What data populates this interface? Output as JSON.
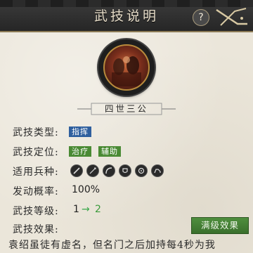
{
  "header": {
    "title": "武技说明",
    "help_label": "?"
  },
  "skill": {
    "name": "四世三公",
    "type_label": "武技类型:",
    "type_tag": "指挥",
    "position_label": "武技定位:",
    "position_tags": [
      "治疗",
      "辅助"
    ],
    "units_label": "适用兵种:",
    "unit_icons": [
      "sword-icon",
      "spear-icon",
      "bow-icon",
      "shield-icon",
      "wheel-icon",
      "cavalry-icon"
    ],
    "chance_label": "发动概率:",
    "chance_value": "100%",
    "level_label": "武技等级:",
    "level_from": "1",
    "level_arrow": "→",
    "level_to": "2",
    "effect_label": "武技效果:",
    "max_button": "满级效果",
    "description": "袁绍虽徒有虚名，但名门之后加持每4秒为我"
  },
  "colors": {
    "accent_blue": "#2f5f9e",
    "accent_green": "#4a8a34",
    "panel": "#ebe6da"
  }
}
